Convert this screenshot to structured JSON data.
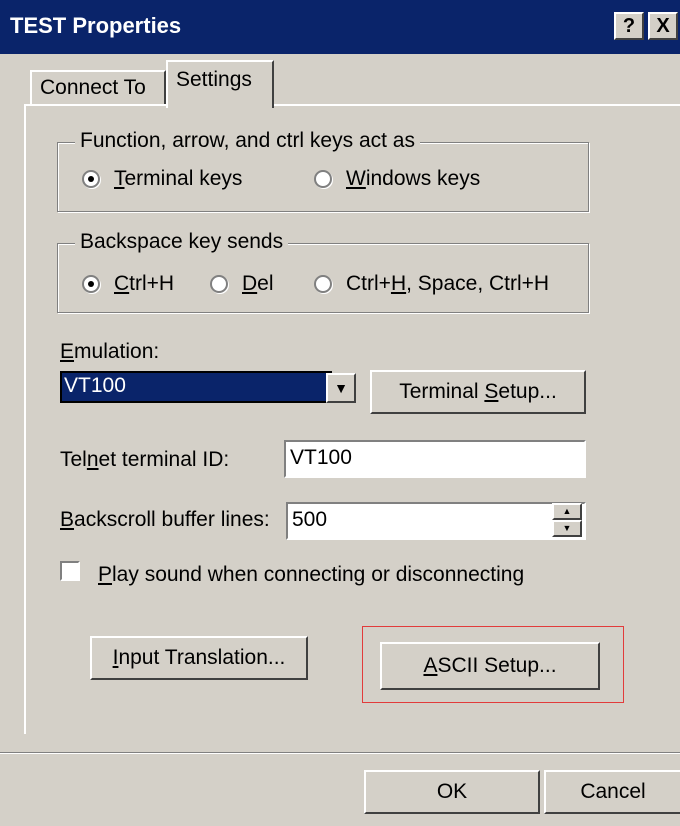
{
  "window": {
    "title": "TEST Properties",
    "help_label": "?",
    "close_label": "X"
  },
  "tabs": [
    {
      "label": "Connect To"
    },
    {
      "label": "Settings"
    }
  ],
  "function_keys_group": {
    "legend": "Function, arrow, and ctrl keys act as",
    "options": [
      {
        "label_pre": "",
        "mnemonic": "T",
        "label_post": "erminal keys",
        "selected": true
      },
      {
        "label_pre": "",
        "mnemonic": "W",
        "label_post": "indows keys",
        "selected": false
      }
    ]
  },
  "backspace_group": {
    "legend": "Backspace key sends",
    "options": [
      {
        "label_pre": "",
        "mnemonic": "C",
        "label_post": "trl+H",
        "selected": true
      },
      {
        "label_pre": "",
        "mnemonic": "D",
        "label_post": "el",
        "selected": false
      },
      {
        "label_pre": "Ctrl+",
        "mnemonic": "H",
        "label_post": ", Space, Ctrl+H",
        "selected": false
      }
    ]
  },
  "emulation": {
    "label_mnemonic": "E",
    "label_rest": "mulation:",
    "value": "VT100",
    "terminal_setup_pre": "Terminal ",
    "terminal_setup_mnemonic": "S",
    "terminal_setup_post": "etup..."
  },
  "telnet": {
    "label_pre": "Tel",
    "label_mnemonic": "n",
    "label_post": "et terminal ID:",
    "value": "VT100"
  },
  "backscroll": {
    "label_mnemonic": "B",
    "label_rest": "ackscroll buffer lines:",
    "value": "500"
  },
  "play_sound": {
    "label_mnemonic": "P",
    "label_rest": "lay sound when connecting or disconnecting",
    "checked": false
  },
  "input_translation": {
    "mnemonic": "I",
    "rest": "nput Translation..."
  },
  "ascii_setup": {
    "mnemonic": "A",
    "rest": "SCII Setup..."
  },
  "footer": {
    "ok_label": "OK",
    "cancel_label": "Cancel"
  },
  "colors": {
    "titlebar": "#0a246a",
    "face": "#d4d0c8",
    "highlight_box": "#e23b3b"
  }
}
